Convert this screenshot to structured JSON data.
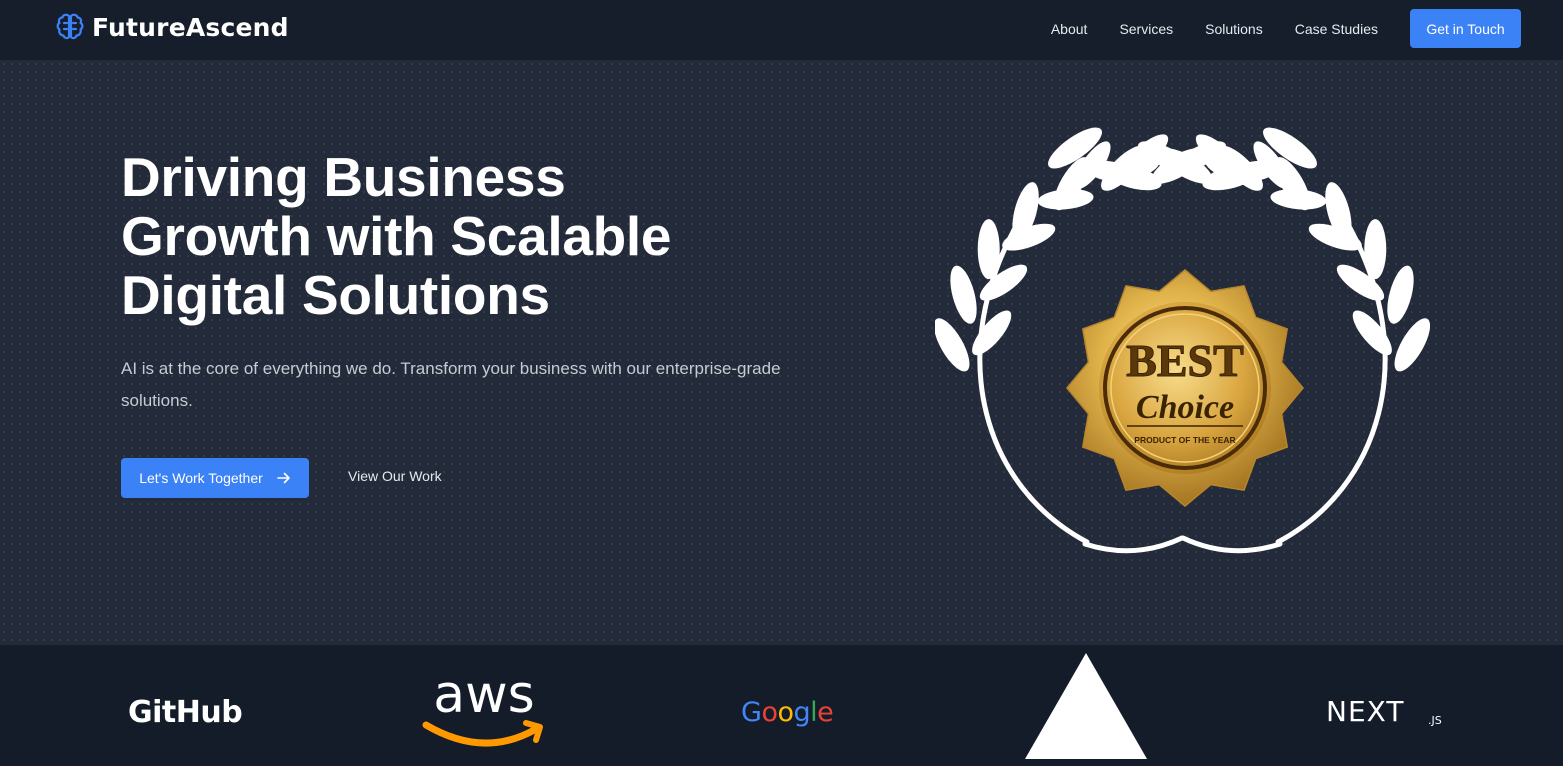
{
  "nav": {
    "brand": "FutureAscend",
    "links": [
      "About",
      "Services",
      "Solutions",
      "Case Studies"
    ],
    "cta": "Get in Touch"
  },
  "hero": {
    "title": "Driving Business Growth with Scalable Digital Solutions",
    "subtitle": "AI is at the core of everything we do. Transform your business with our enterprise-grade solutions.",
    "primary_button": "Let's Work Together",
    "secondary_button": "View Our Work",
    "badge": {
      "line1": "BEST",
      "line2": "Choice",
      "line3": "PRODUCT OF THE YEAR"
    }
  },
  "logos": {
    "github": "GitHub",
    "aws": "aws",
    "google_letters": [
      "G",
      "o",
      "o",
      "g",
      "l",
      "e"
    ],
    "next": "NEXT",
    "next_suffix": ".JS"
  },
  "colors": {
    "accent": "#3b82f6",
    "nav_bg": "#161d2b",
    "hero_bg": "#232b3a",
    "logos_bg": "#141b29",
    "gold": "#d4a53a",
    "aws_orange": "#ff9900",
    "google": [
      "#4285f4",
      "#ea4335",
      "#fbbc05",
      "#4285f4",
      "#34a853",
      "#ea4335"
    ]
  },
  "icons": {
    "brand": "brain-icon",
    "primary_button": "arrow-right-icon",
    "award": "laurel-wreath-icon"
  }
}
